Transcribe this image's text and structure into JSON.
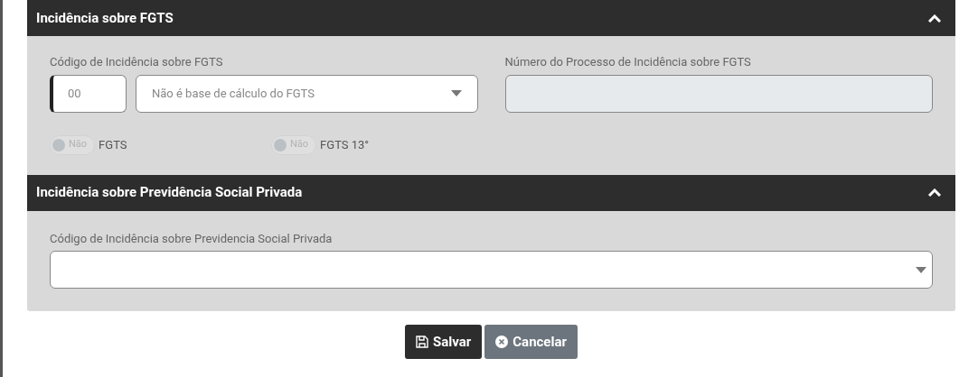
{
  "sections": [
    {
      "title": "Incidência sobre FGTS",
      "expanded": true,
      "kind": "fgts",
      "code_field": {
        "label": "Código de Incidência sobre FGTS",
        "value": "00",
        "select_value": "Não é base de cálculo do FGTS"
      },
      "process_field": {
        "label": "Número do Processo de Incidência sobre FGTS",
        "disabled": true
      },
      "toggles": [
        {
          "state_text": "Não",
          "label": "FGTS",
          "on": false,
          "disabled": true
        },
        {
          "state_text": "Não",
          "label": "FGTS 13°",
          "on": false,
          "disabled": true
        }
      ]
    },
    {
      "title": "Incidência sobre Previdência Social Privada",
      "expanded": true,
      "kind": "select",
      "select_field": {
        "label": "Código de Incidência sobre Previdencia Social Privada"
      }
    }
  ],
  "buttons": [
    {
      "label": "Salvar",
      "kind": "save"
    },
    {
      "label": "Cancelar",
      "kind": "cancel"
    }
  ]
}
